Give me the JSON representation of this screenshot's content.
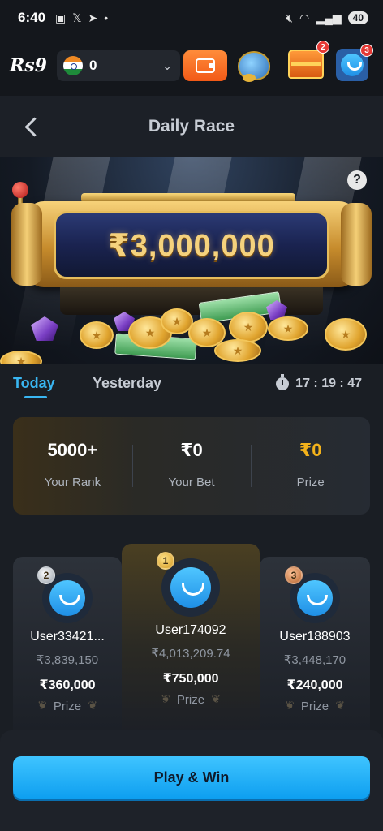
{
  "status_bar": {
    "time": "6:40",
    "battery": "40"
  },
  "top_bar": {
    "logo": "Rs9",
    "balance": "0",
    "notifications": {
      "chest": "2",
      "profile": "3"
    }
  },
  "page": {
    "title": "Daily Race"
  },
  "banner": {
    "jackpot": "₹3,000,000",
    "help": "?"
  },
  "tabs": {
    "today": "Today",
    "yesterday": "Yesterday",
    "countdown": "17 : 19 : 47"
  },
  "stats": [
    {
      "value": "5000+",
      "label": "Your Rank"
    },
    {
      "value": "₹0",
      "label": "Your Bet"
    },
    {
      "value": "₹0",
      "label": "Prize"
    }
  ],
  "podium": {
    "second": {
      "rank": "2",
      "user": "User33421...",
      "amount": "₹3,839,150",
      "prize": "₹360,000",
      "prize_label": "Prize"
    },
    "first": {
      "rank": "1",
      "user": "User174092",
      "amount": "₹4,013,209.74",
      "prize": "₹750,000",
      "prize_label": "Prize"
    },
    "third": {
      "rank": "3",
      "user": "User188903",
      "amount": "₹3,448,170",
      "prize": "₹240,000",
      "prize_label": "Prize"
    }
  },
  "cta": {
    "label": "Play & Win"
  },
  "colors": {
    "accent": "#39b6f2",
    "gold": "#f3b21b",
    "button": "#1aa9f5",
    "wallet": "#f25a17"
  }
}
